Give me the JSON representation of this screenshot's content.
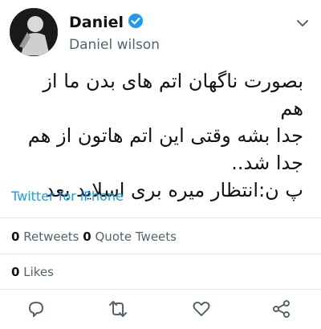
{
  "user": {
    "display_name": "Daniel",
    "handle": "Daniel wilson",
    "verified": true
  },
  "tweet": {
    "text": "بصورت ناگهان اتم های بدن ما از هم\nجدا بشه وقتی این اتم هاتون از هم\nجدا شد..\nپ ن:انتظار میره بری اسلاید بعد",
    "source": "Twitter for iPhone"
  },
  "stats": {
    "retweets_count": "0",
    "retweets_label": "Retweets",
    "quote_count": "0",
    "quote_label": "Quote Tweets",
    "likes_count": "0",
    "likes_label": "Likes"
  },
  "actions": [
    "reply-icon",
    "retweet-icon",
    "like-icon",
    "share-icon"
  ],
  "colors": {
    "accent": "#1d9bf0",
    "muted": "#536471",
    "text": "#0f1419"
  }
}
